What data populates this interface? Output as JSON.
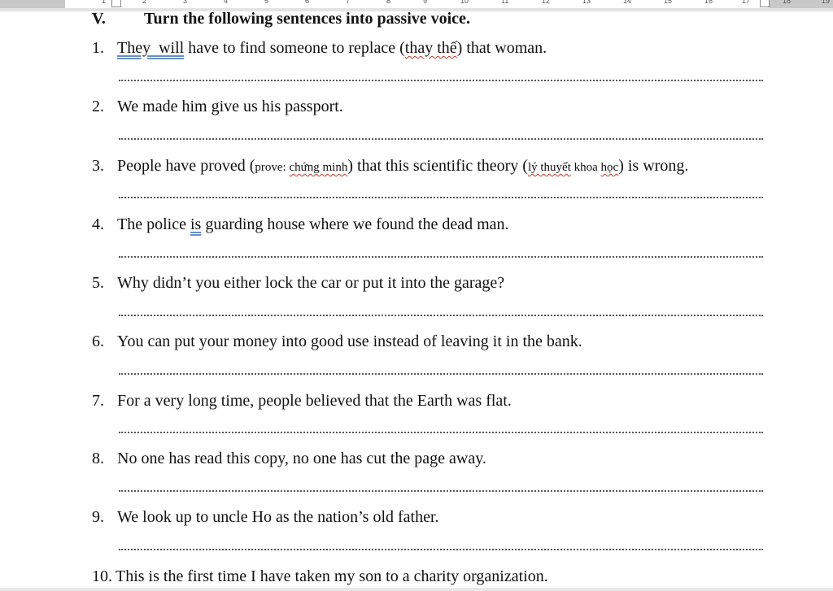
{
  "ruler": {
    "ticks": [
      "1",
      "2",
      "3",
      "4",
      "5",
      "6",
      "7",
      "8",
      "9",
      "10",
      "11",
      "12",
      "13",
      "14",
      "15",
      "16",
      "17",
      "18",
      "19"
    ]
  },
  "section": {
    "number": "V.",
    "title": "Turn the following sentences into passive voice."
  },
  "items": [
    {
      "num": "1.",
      "parts": [
        "They  will",
        " have to find someone to replace (",
        "thay thế",
        ") that woman."
      ]
    },
    {
      "num": "2.",
      "text": "We made him give us his passport."
    },
    {
      "num": "3.",
      "parts": [
        "People have proved (",
        "prove: ",
        "chứng minh",
        ") that this scientific theory (",
        "lý thuyết",
        " khoa ",
        "học",
        ") is wrong."
      ]
    },
    {
      "num": "4.",
      "parts": [
        "The police ",
        "is",
        " guarding house where we found the dead man."
      ]
    },
    {
      "num": "5.",
      "text": "Why didn’t you either lock the car or put it into the garage?"
    },
    {
      "num": "6.",
      "text": "You can put your money into good use instead of leaving it in the bank."
    },
    {
      "num": "7.",
      "text": "For a very long time, people believed that the Earth was flat."
    },
    {
      "num": "8.",
      "text": "No one has read this copy, no one has cut the page away."
    },
    {
      "num": "9.",
      "text": "We look up to uncle Ho as the nation’s old father."
    },
    {
      "num": "10.",
      "text": "This is the first time I have taken my son to a charity organization."
    }
  ]
}
